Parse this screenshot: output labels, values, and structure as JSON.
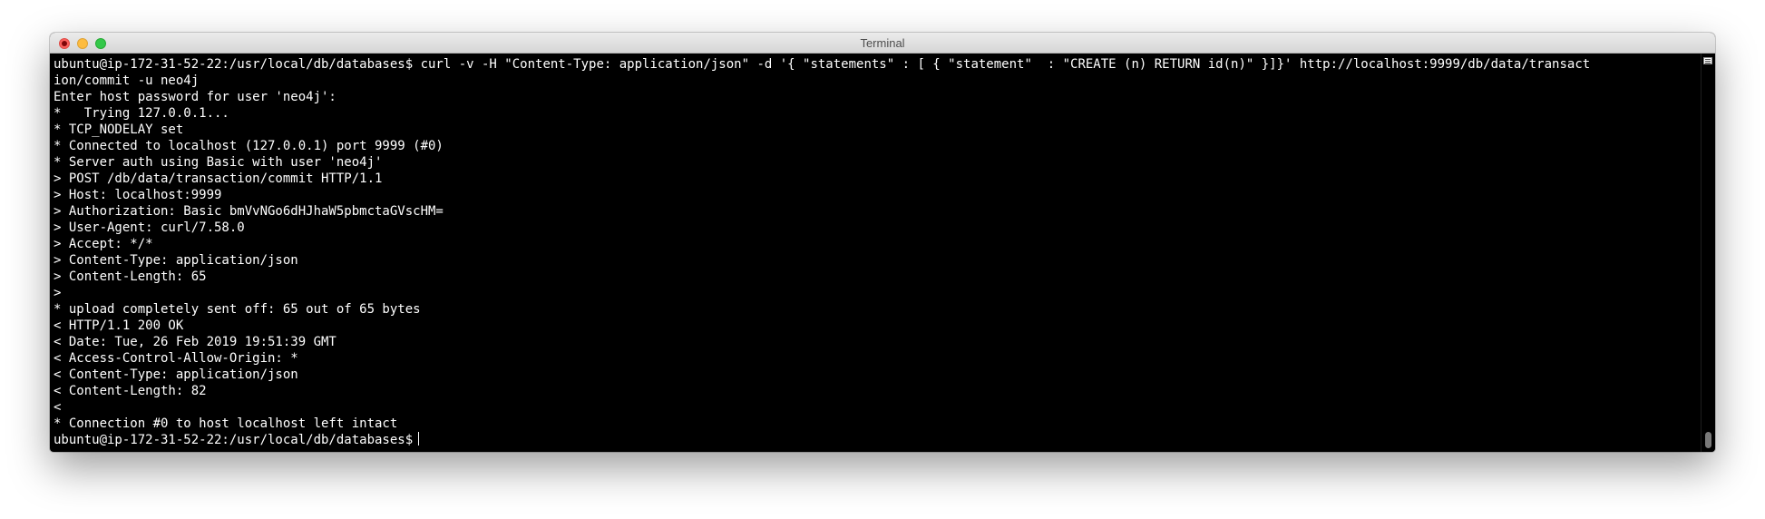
{
  "window": {
    "title": "Terminal"
  },
  "terminal": {
    "lines": [
      "ubuntu@ip-172-31-52-22:/usr/local/db/databases$ curl -v -H \"Content-Type: application/json\" -d '{ \"statements\" : [ { \"statement\"  : \"CREATE (n) RETURN id(n)\" }]}' http://localhost:9999/db/data/transact",
      "ion/commit -u neo4j",
      "Enter host password for user 'neo4j':",
      "*   Trying 127.0.0.1...",
      "* TCP_NODELAY set",
      "* Connected to localhost (127.0.0.1) port 9999 (#0)",
      "* Server auth using Basic with user 'neo4j'",
      "> POST /db/data/transaction/commit HTTP/1.1",
      "> Host: localhost:9999",
      "> Authorization: Basic bmVvNGo6dHJhaW5pbmctaGVscHM=",
      "> User-Agent: curl/7.58.0",
      "> Accept: */*",
      "> Content-Type: application/json",
      "> Content-Length: 65",
      ">",
      "* upload completely sent off: 65 out of 65 bytes",
      "< HTTP/1.1 200 OK",
      "< Date: Tue, 26 Feb 2019 19:51:39 GMT",
      "< Access-Control-Allow-Origin: *",
      "< Content-Type: application/json",
      "< Content-Length: 82",
      "<",
      "* Connection #0 to host localhost left intact"
    ],
    "prompt": "ubuntu@ip-172-31-52-22:/usr/local/db/databases$"
  },
  "colors": {
    "background": "#000000",
    "text": "#ffffff",
    "close": "#fc605c",
    "minimize": "#fdbc40",
    "maximize": "#34c84a"
  }
}
